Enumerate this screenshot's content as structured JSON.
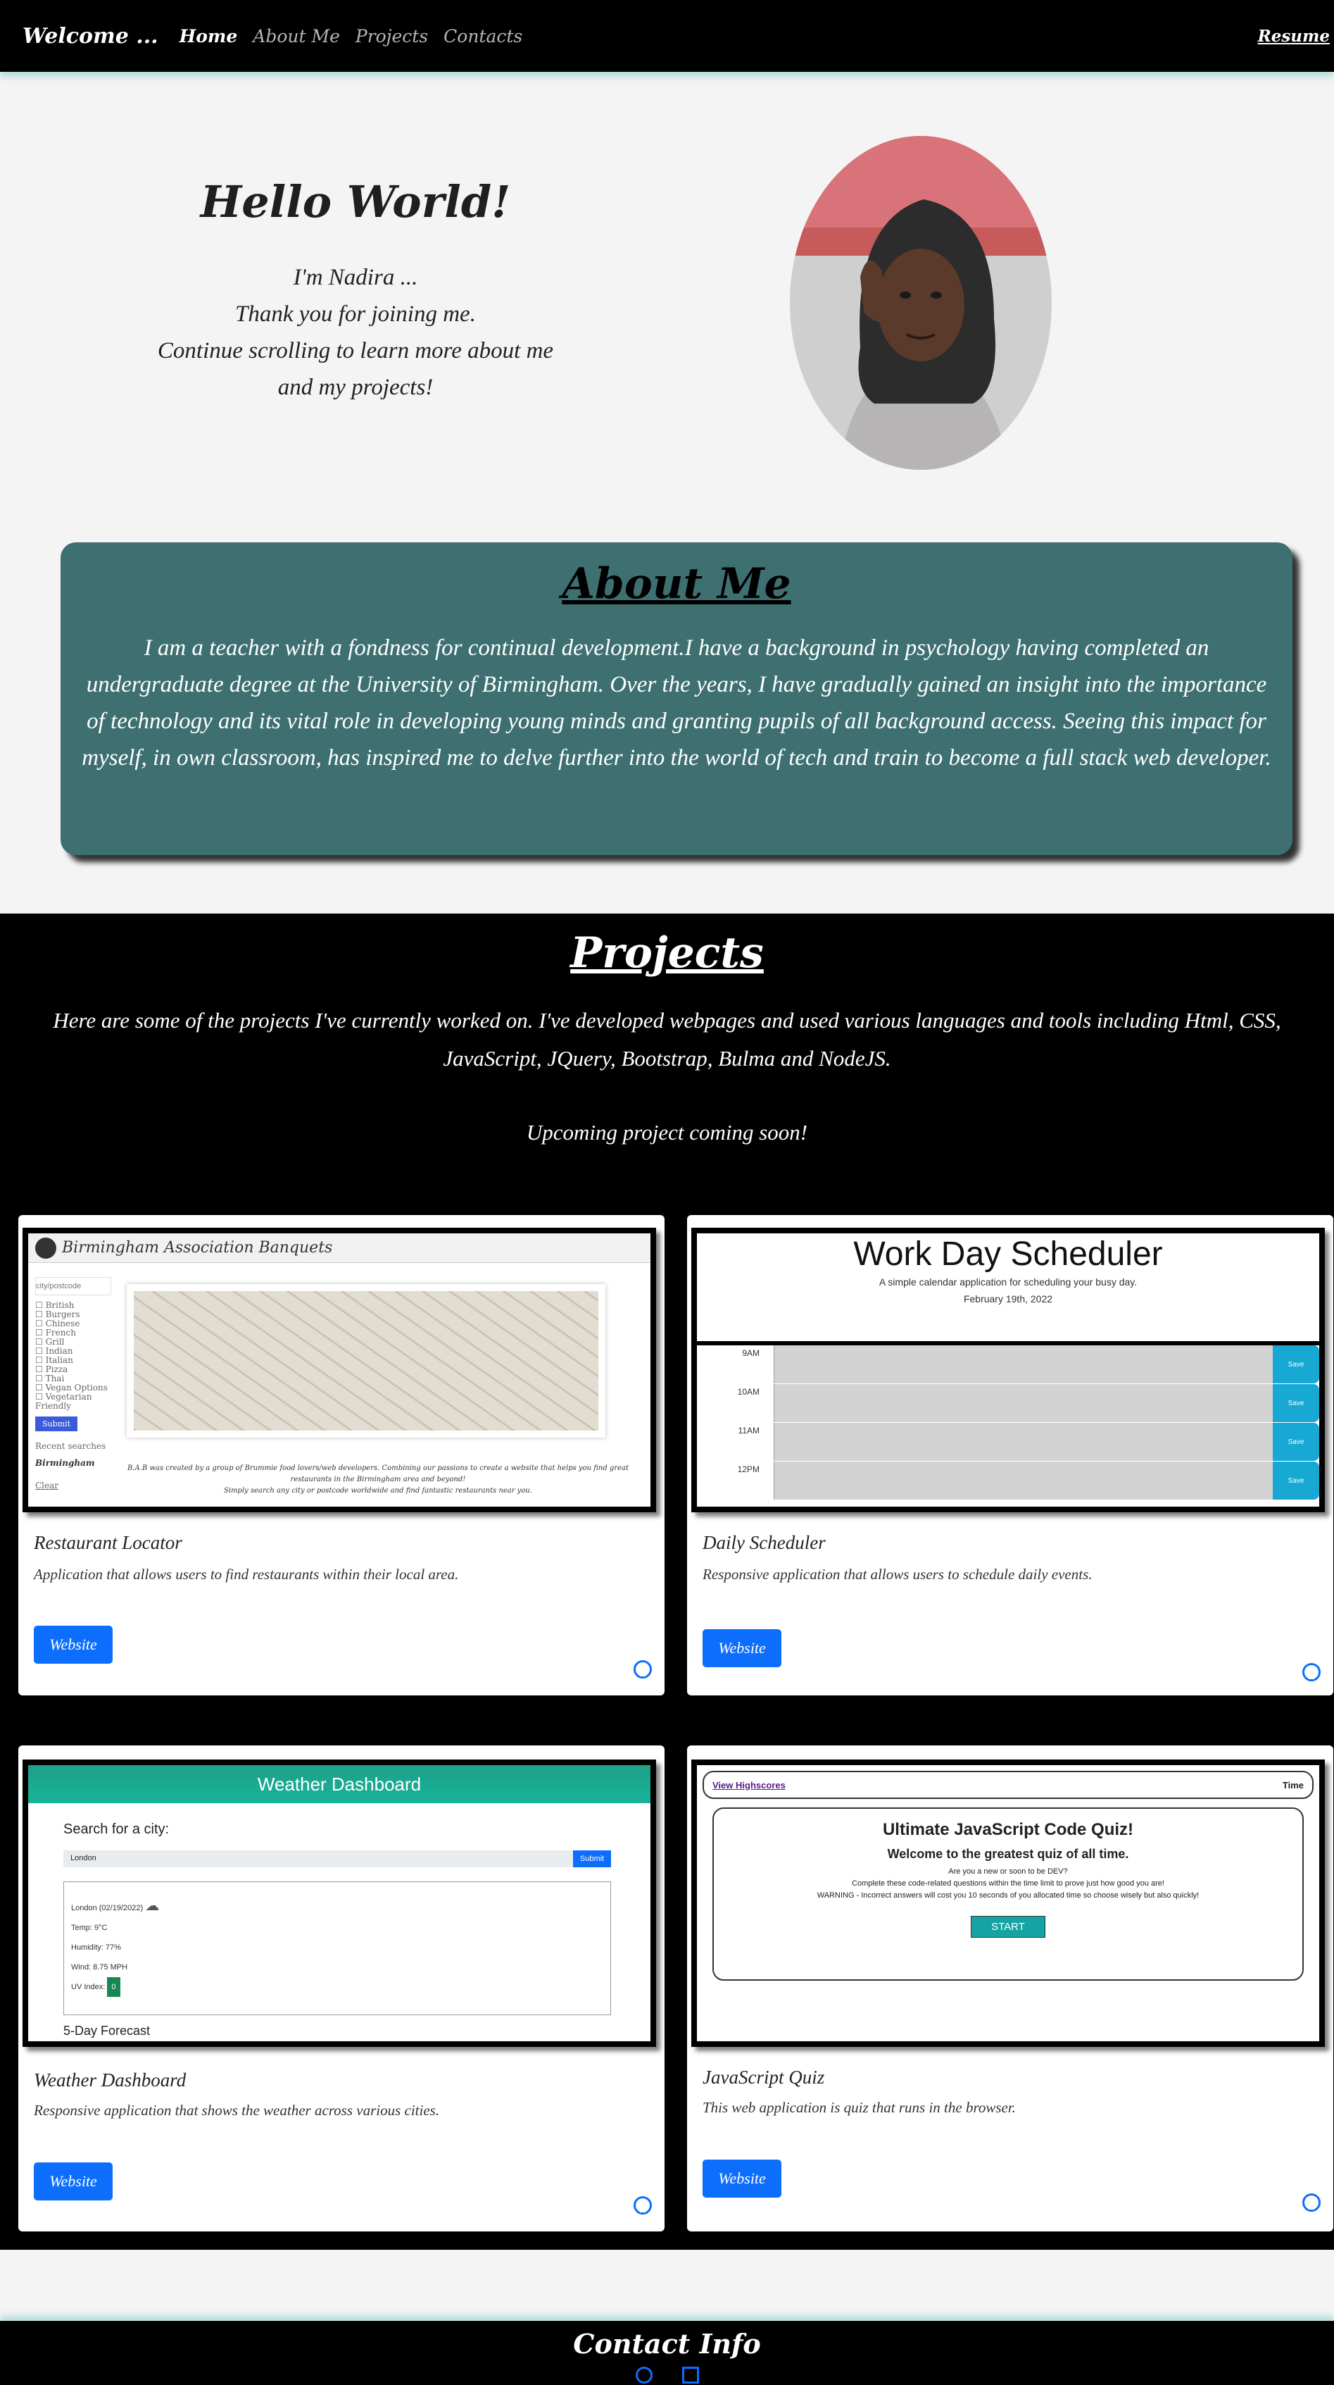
{
  "nav": {
    "brand": "Welcome ...",
    "links": [
      "Home",
      "About Me",
      "Projects",
      "Contacts"
    ],
    "resume": "Resume"
  },
  "hero": {
    "title": "Hello World!",
    "lines": [
      "I'm Nadira ...",
      "Thank you for joining me.",
      "Continue scrolling to learn more about me",
      "and my projects!"
    ]
  },
  "about": {
    "title": "About Me",
    "text": "I am a teacher with a fondness for continual development.I have a background in psychology having completed an undergraduate degree at the University of Birmingham. Over the years, I have gradually gained an insight into the importance of technology and its vital role in developing young minds and granting pupils of all background access. Seeing this impact for myself, in own classroom, has inspired me to delve further into the world of tech and train to become a full stack web developer."
  },
  "projects": {
    "title": "Projects",
    "intro": "Here are some of the projects I've currently worked on. I've developed webpages and used various languages and tools including Html, CSS, JavaScript, JQuery, Bootstrap, Bulma and NodeJS.",
    "upcoming": "Upcoming project coming soon!",
    "cards": [
      {
        "title": "Restaurant Locator",
        "desc": "Application that allows users to find restaurants within their local area.",
        "button": "Website"
      },
      {
        "title": "Daily Scheduler",
        "desc": "Responsive application that allows users to schedule daily events.",
        "button": "Website"
      },
      {
        "title": "Weather Dashboard",
        "desc": "Responsive application that shows the weather across various cities.",
        "button": "Website"
      },
      {
        "title": "JavaScript Quiz",
        "desc": "This web application is quiz that runs in the browser.",
        "button": "Website"
      }
    ]
  },
  "mock_restaurant": {
    "name": "Birmingham Association Banquets",
    "placeholder": "city/postcode",
    "options": [
      "British",
      "Burgers",
      "Chinese",
      "French",
      "Grill",
      "Indian",
      "Italian",
      "Pizza",
      "Thai",
      "Vegan Options",
      "Vegetarian Friendly"
    ],
    "submit": "Submit",
    "recent": "Recent searches",
    "city": "Birmingham",
    "clear": "Clear",
    "footer": "B.A.B was created by a group of Brummie food lovers/web developers. Combining our passions to create a website that helps you find great restaurants in the Birmingham area and beyond!",
    "footer2": "Simply search any city or postcode worldwide and find fantastic restaurants near you."
  },
  "mock_scheduler": {
    "title": "Work Day Scheduler",
    "subtitle": "A simple calendar application for scheduling your busy day.",
    "date": "February 19th, 2022",
    "hours": [
      "9AM",
      "10AM",
      "11AM",
      "12PM"
    ],
    "save": "Save"
  },
  "mock_weather": {
    "header": "Weather Dashboard",
    "label": "Search for a city:",
    "value": "London",
    "submit": "Submit",
    "city_date": "London (02/19/2022)",
    "temp": "Temp: 9°C",
    "humidity": "Humidity: 77%",
    "wind": "Wind: 8.75 MPH",
    "uv_label": "UV Index:",
    "uv": "0",
    "five_day": "5-Day Forecast"
  },
  "mock_quiz": {
    "highscores": "View Highscores",
    "time": "Time",
    "title": "Ultimate JavaScript Code Quiz!",
    "welcome": "Welcome to the greatest quiz of all time.",
    "p1": "Are you a new or soon to be DEV?",
    "p2": "Complete these code-related questions within the time limit to prove just how good you are!",
    "p3": "WARNING - Incorrect answers will cost you 10 seconds of you allocated time so choose wisely but also quickly!",
    "start": "START"
  },
  "footer": {
    "title": "Contact Info"
  }
}
